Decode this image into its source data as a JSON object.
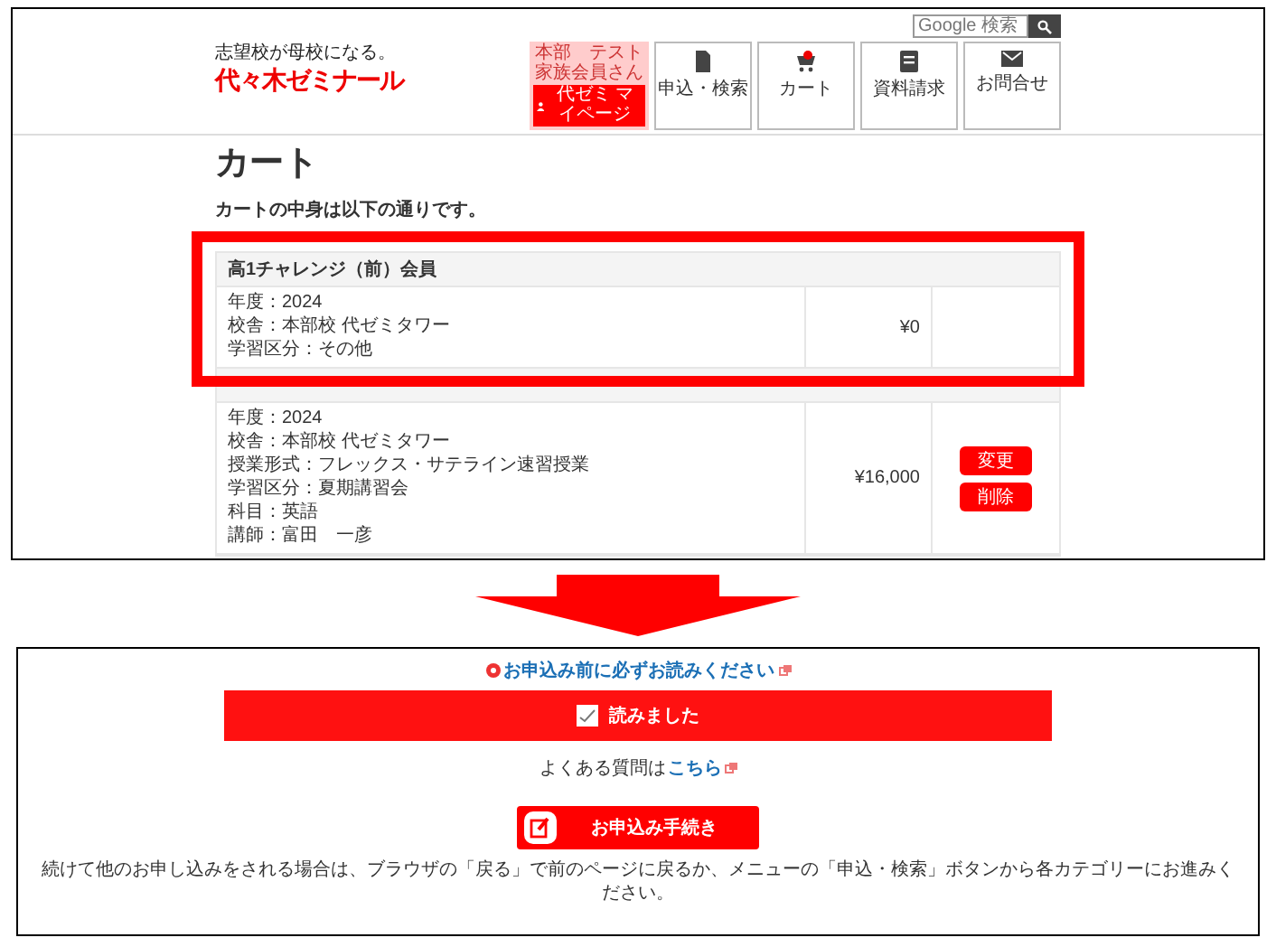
{
  "top_screen": {
    "tagline": "志望校が母校になる。",
    "logo": "代々木ゼミナール",
    "search": {
      "placeholder": "Google 検索"
    },
    "account": {
      "greeting": "本部　テスト家族会員さん",
      "mypage": "代ゼミ マイページ"
    },
    "nav": [
      {
        "label": "申込・検索",
        "kind": "doc"
      },
      {
        "label": "カート",
        "kind": "cart"
      },
      {
        "label": "資料請求",
        "kind": "book"
      },
      {
        "label": "お問合せ",
        "kind": "mail"
      }
    ],
    "page_title": "カート",
    "intro": "カートの中身は以下の通りです。",
    "cart_items": [
      {
        "header": "高1チャレンジ（前）会員",
        "details": [
          "年度：2024",
          "校舎：本部校 代ゼミタワー",
          "学習区分：その他"
        ],
        "price": "¥0"
      },
      {
        "details": [
          "年度：2024",
          "校舎：本部校 代ゼミタワー",
          "授業形式：フレックス・サテライン速習授業",
          "学習区分：夏期講習会",
          "科目：英語",
          "講師：富田　一彦"
        ],
        "price": "¥16,000",
        "actions": [
          "変更",
          "削除"
        ]
      }
    ]
  },
  "bottom_screen": {
    "notice": "お申込み前に必ずお読みください",
    "confirm": {
      "label": "読みました",
      "checked": true
    },
    "faq": {
      "text": "よくある質問は",
      "link": "こちら"
    },
    "submit": "お申込み手続き",
    "note": "続けて他のお申し込みをされる場合は、ブラウザの「戻る」で前のページに戻るか、メニューの「申込・検索」ボタンから各カテゴリーにお進みください。"
  }
}
